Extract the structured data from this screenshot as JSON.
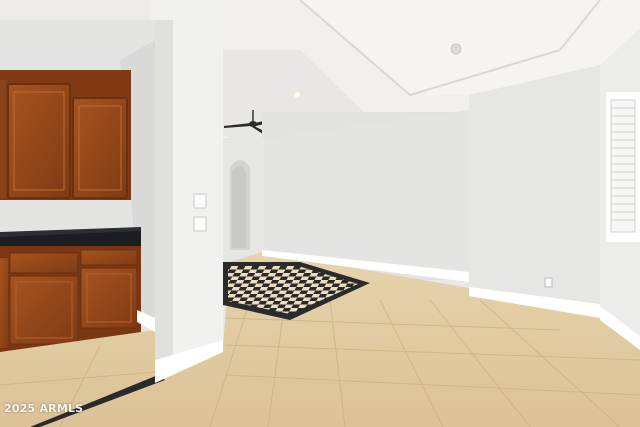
{
  "watermark": {
    "text": "2025 ARMLS"
  },
  "colors": {
    "wall": "#e3e3e2",
    "ceiling": "#f0efee",
    "tile": "#e0c9a0",
    "cabinet": "#9a4a1c",
    "countertop": "#1b1c20",
    "baseboard": "#ffffff"
  }
}
